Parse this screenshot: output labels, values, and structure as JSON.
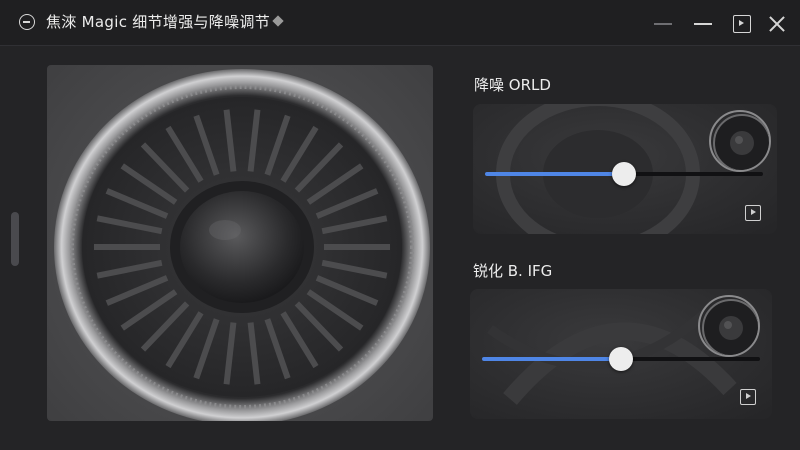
{
  "window": {
    "title": "焦淶 Magic 细节增强与降噪调节",
    "controls": [
      "minimize-alt",
      "minimize",
      "maximize",
      "close"
    ]
  },
  "preview": {
    "subject": "speaker-grille"
  },
  "denoise": {
    "label": "降噪 ORLD",
    "slider_value_fraction": 0.5,
    "accent": "#4f86e6"
  },
  "sharpen": {
    "label": "锐化 B. IFG",
    "slider_value_fraction": 0.5,
    "accent": "#4f86e6"
  },
  "icons": {
    "app": "app-logo-icon",
    "preview_play": "play-square-icon"
  }
}
